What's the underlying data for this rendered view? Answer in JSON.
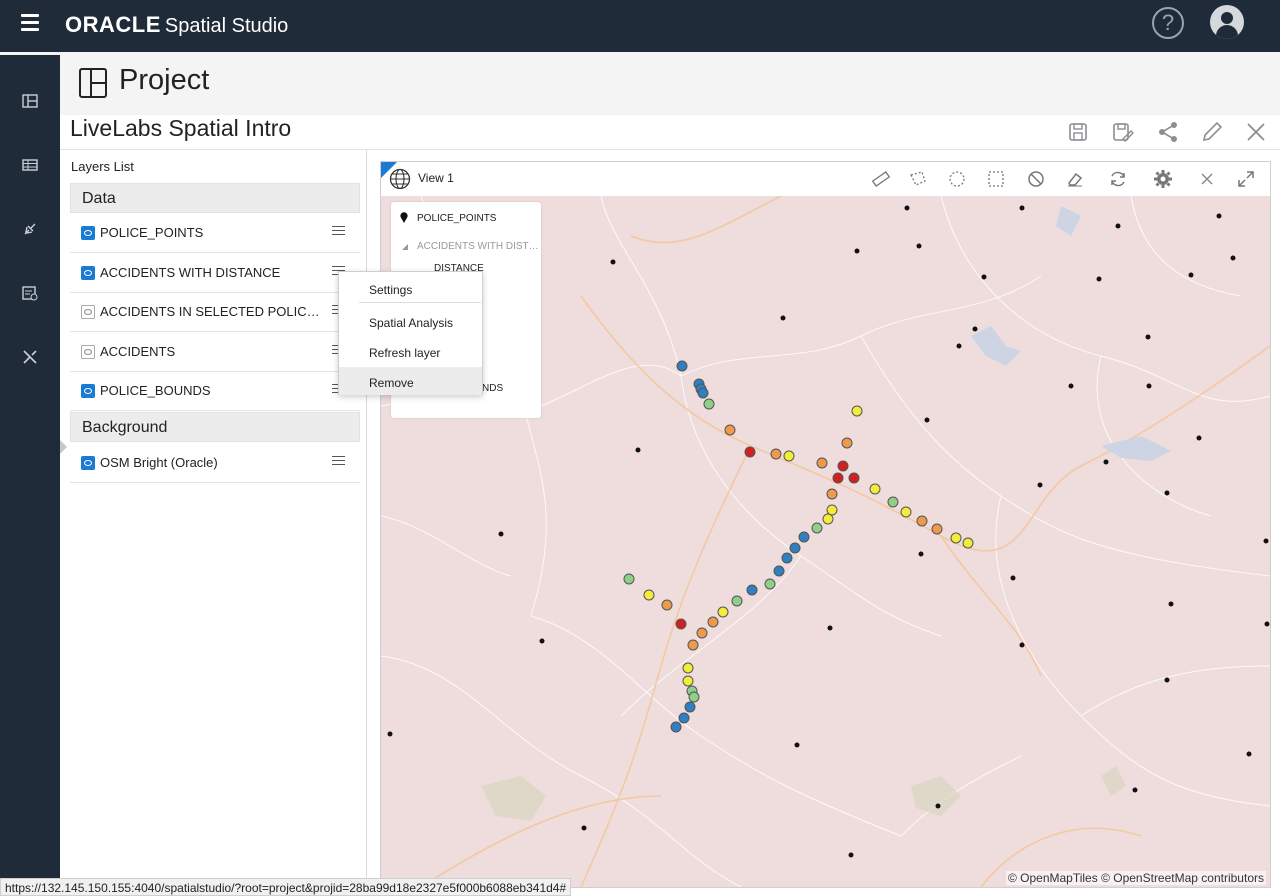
{
  "header": {
    "brand": "ORACLE",
    "product": "Spatial Studio",
    "help_icon": "?"
  },
  "page": {
    "title": "Project",
    "project_name": "LiveLabs Spatial Intro"
  },
  "layers_panel": {
    "title": "Layers List",
    "sections": [
      {
        "label": "Data"
      },
      {
        "label": "Background"
      }
    ],
    "layers": [
      {
        "name": "POLICE_POINTS",
        "visible": true
      },
      {
        "name": "ACCIDENTS WITH DISTANCE",
        "visible": true
      },
      {
        "name": "ACCIDENTS IN SELECTED POLICE_B…",
        "visible": false
      },
      {
        "name": "ACCIDENTS",
        "visible": false
      },
      {
        "name": "POLICE_BOUNDS",
        "visible": true
      }
    ],
    "background_layers": [
      {
        "name": "OSM Bright (Oracle)",
        "visible": true
      }
    ]
  },
  "context_menu": {
    "items": [
      "Settings",
      "Spatial Analysis",
      "Refresh layer",
      "Remove"
    ]
  },
  "view": {
    "title": "View 1",
    "legend": {
      "items": [
        "POLICE_POINTS",
        "ACCIDENTS WITH DIST…",
        "DISTANCE",
        "NDS"
      ]
    },
    "attribution": "© OpenMapTiles  © OpenStreetMap contributors",
    "colors": {
      "blue": "#2f7fc1",
      "green": "#8fcf8a",
      "yellow": "#f2ec3a",
      "orange": "#ee9a4d",
      "red": "#d21f1f"
    }
  },
  "status_url": "https://132.145.150.155:4040/spatialstudio/?root=project&projid=28ba99d18e2327e5f000b6088eb341d4#"
}
